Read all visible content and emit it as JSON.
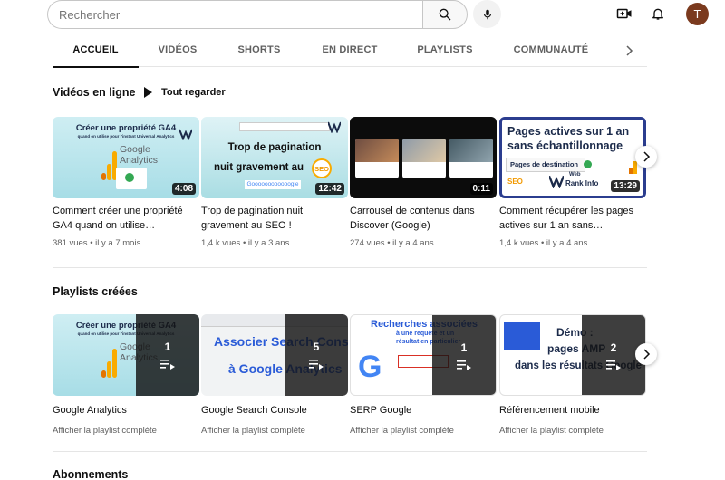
{
  "search": {
    "placeholder": "Rechercher"
  },
  "profile": {
    "initial": "T"
  },
  "tabs": [
    {
      "label": "ACCUEIL",
      "active": true
    },
    {
      "label": "VIDÉOS"
    },
    {
      "label": "SHORTS"
    },
    {
      "label": "EN DIRECT"
    },
    {
      "label": "PLAYLISTS"
    },
    {
      "label": "COMMUNAUTÉ"
    }
  ],
  "videos_section": {
    "title": "Vidéos en ligne",
    "play_all": "Tout regarder",
    "items": [
      {
        "title": "Comment créer une propriété GA4 quand on utilise…",
        "views": "381 vues",
        "age": "il y a 7 mois",
        "duration": "4:08",
        "thumb": {
          "headline": "Créer une propriété GA4",
          "subline": "quand on utilise pour l'instant Universal Analytics",
          "brand": "Google Analytics"
        }
      },
      {
        "title": "Trop de pagination nuit gravement au SEO !",
        "views": "1,4 k vues",
        "age": "il y a 3 ans",
        "duration": "12:42",
        "thumb": {
          "headline_1": "Trop de pagination",
          "headline_2": "nuit gravement au",
          "badge": "SEO",
          "brand": "Goooooooooooogle"
        }
      },
      {
        "title": "Carrousel de contenus dans Discover (Google)",
        "views": "274 vues",
        "age": "il y a 4 ans",
        "duration": "0:11"
      },
      {
        "title": "Comment récupérer les pages actives sur 1 an sans…",
        "views": "1,4 k vues",
        "age": "il y a 4 ans",
        "duration": "13:29",
        "thumb": {
          "headline_1": "Pages actives sur 1 an",
          "headline_2": "sans échantillonnage",
          "label": "Pages de destination",
          "badge": "SEO",
          "brand_1": "Web",
          "brand_2": "Rank Info"
        }
      }
    ]
  },
  "playlists_section": {
    "title": "Playlists créées",
    "link_label": "Afficher la playlist complète",
    "items": [
      {
        "title": "Google Analytics",
        "count": "1",
        "thumb": {
          "headline": "Créer une propriété GA4",
          "subline": "quand on utilise pour l'instant Universal Analytics",
          "brand": "Google Analytics"
        }
      },
      {
        "title": "Google Search Console",
        "count": "5",
        "thumb": {
          "headline_1": "Associer Search Console",
          "headline_2": "à Google Analytics"
        }
      },
      {
        "title": "SERP Google",
        "count": "1",
        "thumb": {
          "headline": "Recherches associées",
          "subline_1": "à une requête et un",
          "subline_2": "résultat en particulier",
          "logo": "G"
        }
      },
      {
        "title": "Référencement mobile",
        "count": "2",
        "thumb": {
          "headline_1": "Démo :",
          "headline_2": "pages AMP",
          "headline_3": "dans les résultats Google"
        }
      }
    ]
  },
  "subscriptions_section": {
    "title": "Abonnements"
  },
  "colors": {
    "accent_blue": "#2a5bd7",
    "teal": "#4fc3c8",
    "ga_orange": "#f9ab00",
    "dark_navy": "#1b2a4a"
  }
}
